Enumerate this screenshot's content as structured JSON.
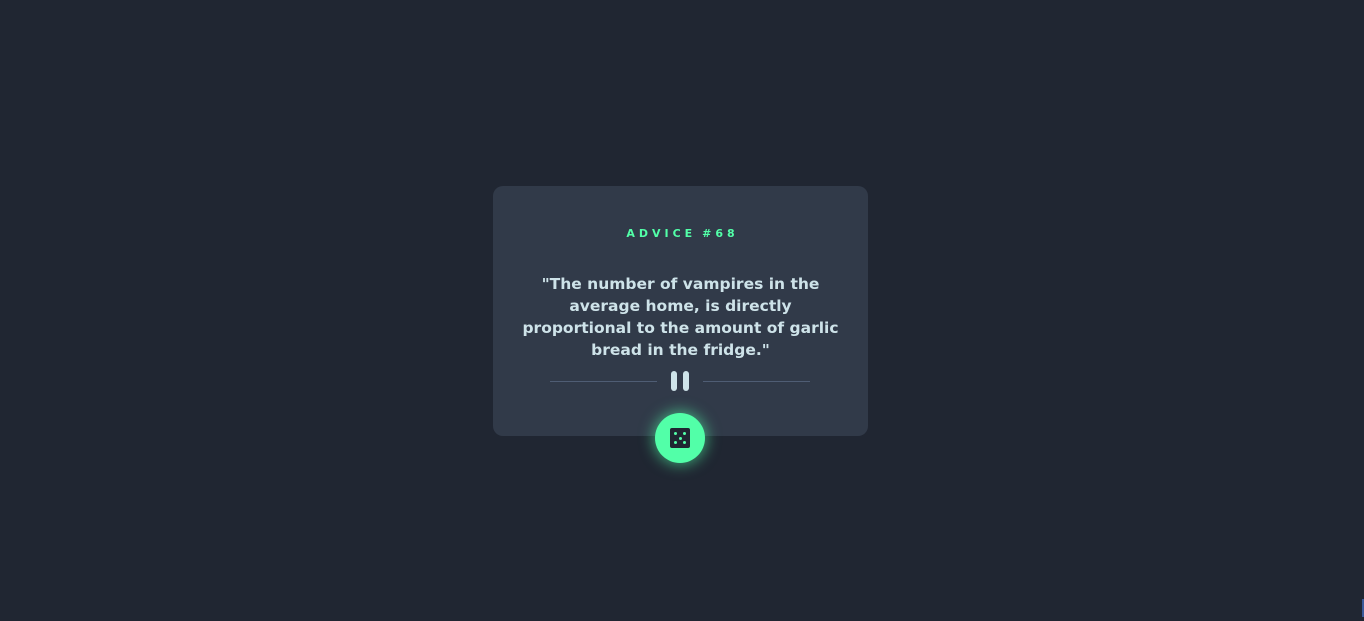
{
  "advice": {
    "label": "ADVICE",
    "number": "#68",
    "quote": "\"The number of vampires in the average home, is directly proportional to the amount of garlic bread in the fridge.\""
  },
  "icons": {
    "divider": "pause-icon",
    "button": "dice-icon"
  },
  "colors": {
    "background": "#202632",
    "card": "#313a49",
    "accent": "#52ffa8",
    "text": "#cee3e9",
    "divider": "#4f5d74"
  }
}
